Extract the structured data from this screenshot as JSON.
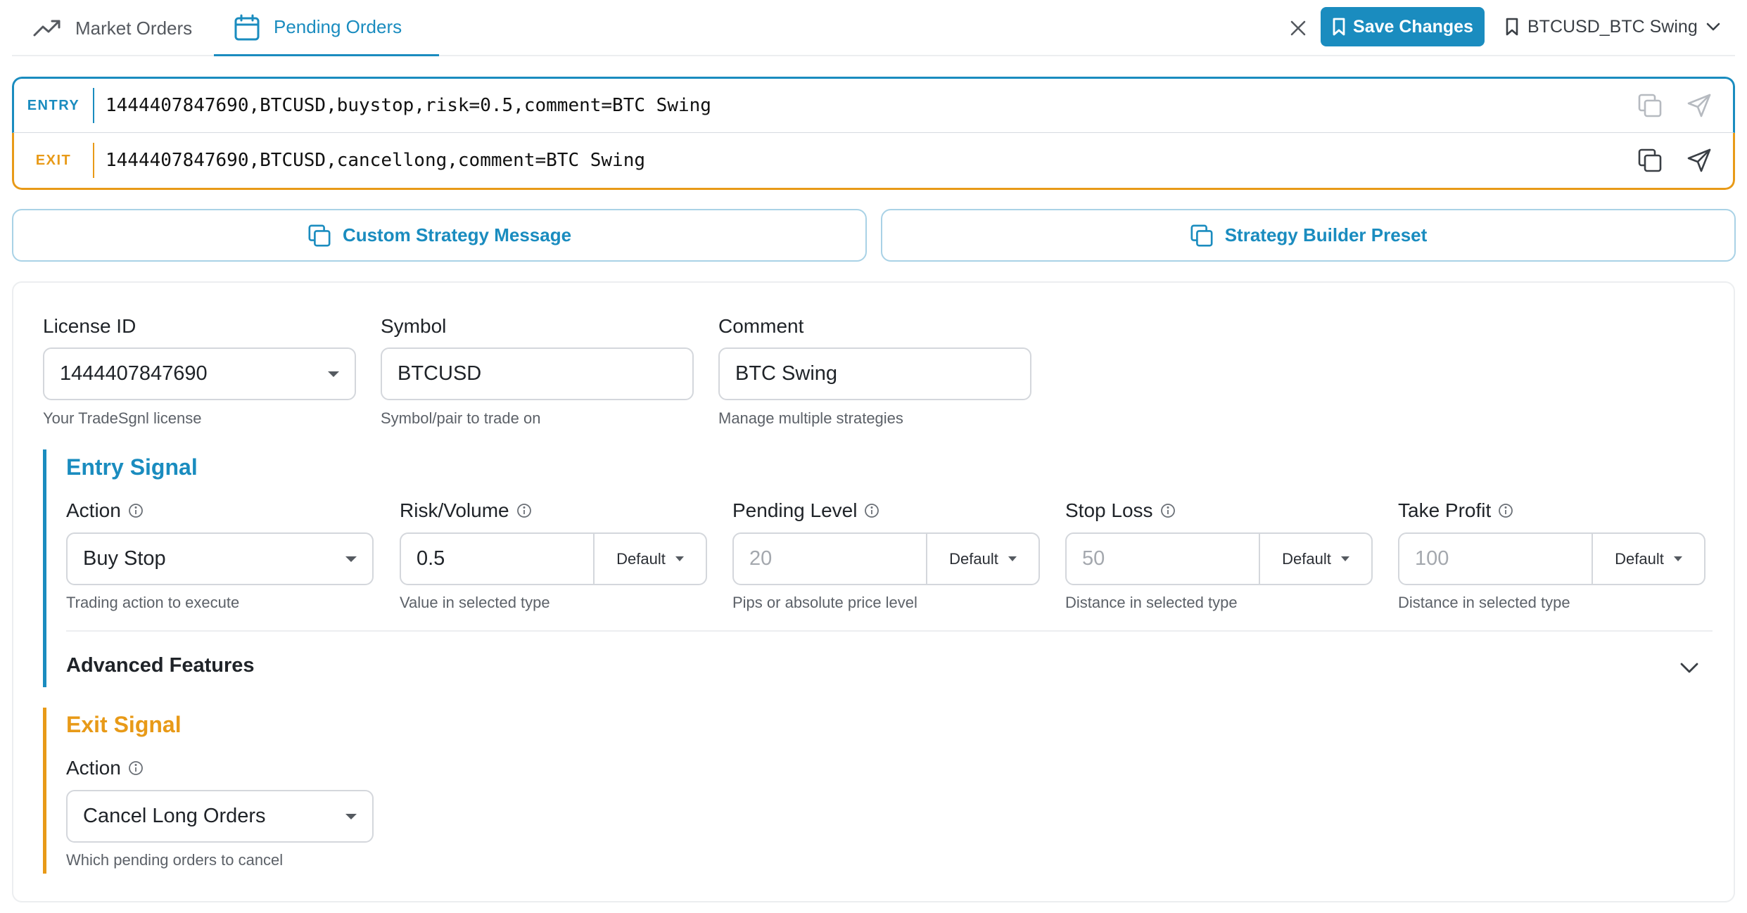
{
  "tabs": [
    {
      "label": "Market Orders",
      "active": false
    },
    {
      "label": "Pending Orders",
      "active": true
    }
  ],
  "toolbar": {
    "save_label": "Save Changes",
    "preset_name": "BTCUSD_BTC Swing"
  },
  "messages": {
    "entry": {
      "label": "ENTRY",
      "text": "1444407847690,BTCUSD,buystop,risk=0.5,comment=BTC Swing"
    },
    "exit": {
      "label": "EXIT",
      "text": "1444407847690,BTCUSD,cancellong,comment=BTC Swing"
    }
  },
  "presets": {
    "custom_label": "Custom Strategy Message",
    "builder_label": "Strategy Builder Preset"
  },
  "form": {
    "license": {
      "label": "License ID",
      "value": "1444407847690",
      "helper": "Your TradeSgnl license"
    },
    "symbol": {
      "label": "Symbol",
      "value": "BTCUSD",
      "helper": "Symbol/pair to trade on"
    },
    "comment": {
      "label": "Comment",
      "value": "BTC Swing",
      "helper": "Manage multiple strategies"
    }
  },
  "entry_signal": {
    "title": "Entry Signal",
    "action": {
      "label": "Action",
      "value": "Buy Stop",
      "helper": "Trading action to execute"
    },
    "risk": {
      "label": "Risk/Volume",
      "value": "0.5",
      "unit": "Default",
      "helper": "Value in selected type"
    },
    "pending": {
      "label": "Pending Level",
      "placeholder": "20",
      "unit": "Default",
      "helper": "Pips or absolute price level"
    },
    "stop_loss": {
      "label": "Stop Loss",
      "placeholder": "50",
      "unit": "Default",
      "helper": "Distance in selected type"
    },
    "take_profit": {
      "label": "Take Profit",
      "placeholder": "100",
      "unit": "Default",
      "helper": "Distance in selected type"
    }
  },
  "advanced": {
    "title": "Advanced Features"
  },
  "exit_signal": {
    "title": "Exit Signal",
    "action": {
      "label": "Action",
      "value": "Cancel Long Orders",
      "helper": "Which pending orders to cancel"
    }
  },
  "colors": {
    "accent": "#1a8cbf",
    "exit_accent": "#e89a18"
  }
}
